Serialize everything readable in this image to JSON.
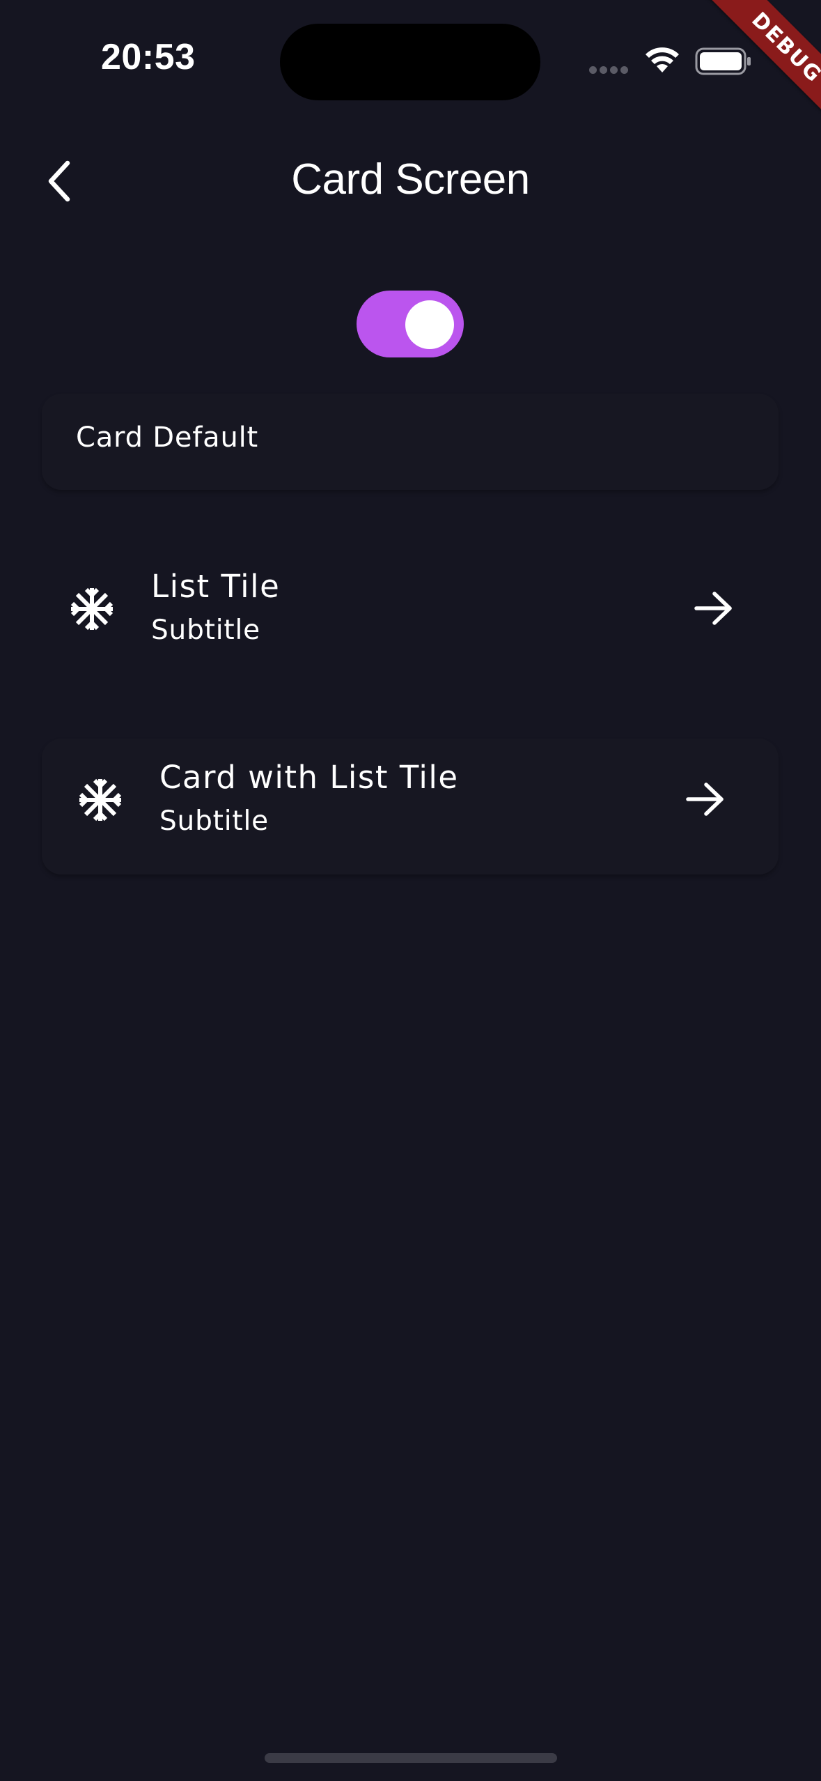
{
  "status_bar": {
    "time": "20:53"
  },
  "debug_banner": {
    "label": "DEBUG",
    "color": "#8a1b1b"
  },
  "app_bar": {
    "title": "Card Screen",
    "back_icon": "chevron-left-icon"
  },
  "toggle": {
    "state": "on",
    "accent_color": "#bb55ee"
  },
  "card_default": {
    "label": "Card Default"
  },
  "list_tile": {
    "leading_icon": "snowflake-icon",
    "title": "List Tile",
    "subtitle": "Subtitle",
    "trailing_icon": "arrow-right-icon"
  },
  "card_list_tile": {
    "leading_icon": "snowflake-icon",
    "title": "Card with List Tile",
    "subtitle": "Subtitle",
    "trailing_icon": "arrow-right-icon"
  },
  "colors": {
    "background": "#151521",
    "card": "#171722"
  }
}
